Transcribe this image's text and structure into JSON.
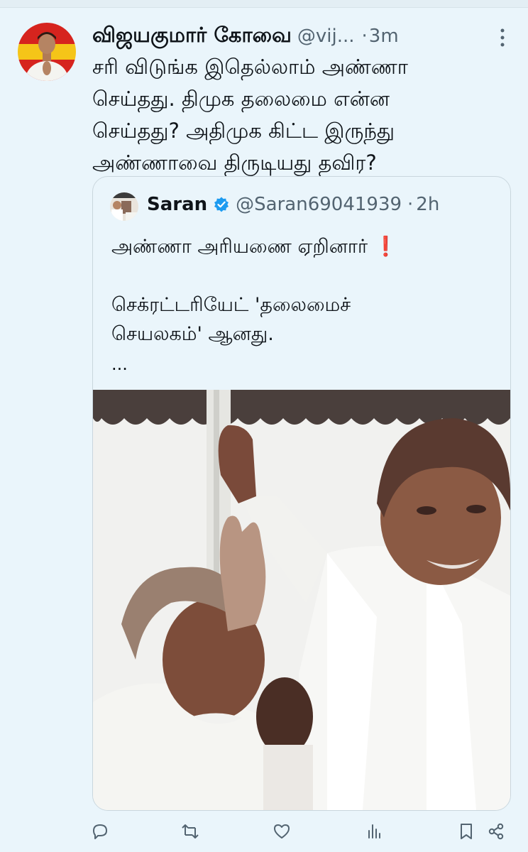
{
  "tweet": {
    "display_name": "விஜயகுமார் கோவை",
    "handle": "@vij...",
    "separator": "·",
    "time": "3m",
    "text": "சரி விடுங்க இதெல்லாம் அண்ணா\nசெய்தது. திமுக தலைமை என்ன\nசெய்தது? அதிமுக கிட்ட இருந்து\nஅண்ணாவை திருடியது தவிர?",
    "avatar_icon": "person-avatar-icon",
    "more_icon": "vertical-dots-icon"
  },
  "quote": {
    "display_name": "Saran",
    "verified": true,
    "handle": "@Saran69041939",
    "separator": "·",
    "time": "2h",
    "text": "அண்ணா அரியணை ஏறினார் ❗\n\nசெக்ரட்டரியேட் 'தலைமைச்\nசெயலகம்' ஆனது.",
    "ellipsis": "...",
    "media_icon": "photo-image"
  },
  "actions": [
    {
      "name": "reply",
      "icon": "reply-icon"
    },
    {
      "name": "retweet",
      "icon": "retweet-icon"
    },
    {
      "name": "like",
      "icon": "heart-icon"
    },
    {
      "name": "views",
      "icon": "views-icon"
    },
    {
      "name": "bookmark",
      "icon": "bookmark-icon"
    },
    {
      "name": "share",
      "icon": "share-icon"
    }
  ],
  "colors": {
    "background": "#eaf5fb",
    "text": "#0f1419",
    "secondary": "#536471",
    "verified": "#1d9bf0",
    "flag_red": "#d6241e",
    "flag_yellow": "#f5c518"
  }
}
